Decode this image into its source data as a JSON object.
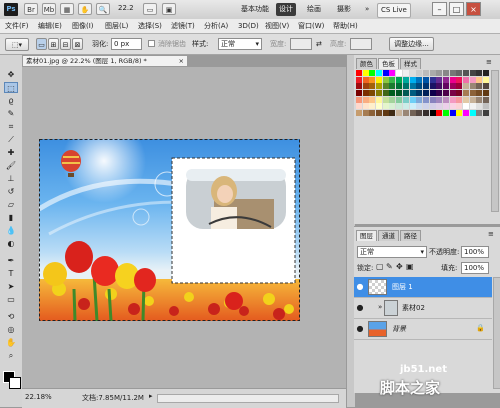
{
  "app": {
    "logo": "Ps",
    "zoom": "22.2",
    "workspaces": [
      "基本功能",
      "设计",
      "绘画",
      "摄影"
    ],
    "more": "»",
    "cs_live": "CS Live",
    "win_min": "–",
    "win_max": "□",
    "win_close": "×"
  },
  "menu": {
    "items": [
      "文件(F)",
      "编辑(E)",
      "图像(I)",
      "图层(L)",
      "选择(S)",
      "滤镜(T)",
      "分析(A)",
      "3D(D)",
      "视图(V)",
      "窗口(W)",
      "帮助(H)"
    ]
  },
  "options": {
    "feather_label": "羽化:",
    "feather_value": "0 px",
    "antialias_label": "消除锯齿",
    "style_label": "样式:",
    "style_value": "正常",
    "width_label": "宽度:",
    "height_label": "高度:",
    "refine_button": "调整边缘..."
  },
  "document": {
    "tab_title": "素材01.jpg @ 22.2% (图层 1, RGB/8) *",
    "close": "×",
    "zoom": "22.18%",
    "doc_info": "文档:7.85M/11.2M"
  },
  "swatches": {
    "tabs": [
      "颜色",
      "色板",
      "样式"
    ],
    "colors": [
      [
        "#ff0000",
        "#ffff00",
        "#00ff00",
        "#00ffff",
        "#0000ff",
        "#ff00ff",
        "#ffffff",
        "#eeeeee",
        "#dddddd",
        "#cccccc",
        "#bbbbbb",
        "#aaaaaa",
        "#999999",
        "#888888",
        "#777777",
        "#666666",
        "#555555",
        "#444444",
        "#333333",
        "#222222"
      ],
      [
        "#ed1c24",
        "#f26522",
        "#f7941d",
        "#fff200",
        "#8dc63f",
        "#39b54a",
        "#00a651",
        "#00a99d",
        "#00aeef",
        "#0072bc",
        "#0054a6",
        "#2e3192",
        "#662d91",
        "#92278f",
        "#ec008c",
        "#ed145b",
        "#f06eaa",
        "#f49ac1",
        "#fdc689",
        "#fff799"
      ],
      [
        "#9e0b0f",
        "#a0410d",
        "#a36209",
        "#aba000",
        "#598527",
        "#1a7b30",
        "#007236",
        "#00746b",
        "#0076a3",
        "#004a80",
        "#003471",
        "#1b1464",
        "#440e62",
        "#630460",
        "#9e005d",
        "#9e0039",
        "#c6b198",
        "#998675",
        "#736357",
        "#534741"
      ],
      [
        "#790000",
        "#7b2e00",
        "#7d4900",
        "#827b00",
        "#406618",
        "#005e20",
        "#005826",
        "#005952",
        "#005b7f",
        "#003663",
        "#002157",
        "#0d004c",
        "#32004b",
        "#4b0049",
        "#7b0046",
        "#7a0026",
        "#a67c52",
        "#8c6239",
        "#754c24",
        "#603913"
      ],
      [
        "#f7977a",
        "#f9ad81",
        "#fdc68a",
        "#fff79a",
        "#c4df9b",
        "#a3d39c",
        "#82ca9d",
        "#7bcdc8",
        "#6ecff6",
        "#7ea7d8",
        "#8493ca",
        "#8882be",
        "#a187be",
        "#bc8dbf",
        "#f49ac2",
        "#f6989d",
        "#e2c9a5",
        "#c7b299",
        "#998675",
        "#736357"
      ],
      [
        "#ffd8cc",
        "#ffe4cc",
        "#fff0cc",
        "#ffffcc",
        "#e5f5cc",
        "#d8f0d4",
        "#ccebd9",
        "#ccece8",
        "#cceffa",
        "#ccdcf0",
        "#cfd4ea",
        "#d4cfe8",
        "#e0d0e8",
        "#ecd0ea",
        "#fad4e5",
        "#fcd4d6",
        "#ffffff",
        "#f2f2f2",
        "#e0e0e0",
        "#c0c0c0"
      ],
      [
        "#c69c6d",
        "#a67c52",
        "#8c6239",
        "#754c24",
        "#603913",
        "#3f2a14",
        "#c7b299",
        "#998675",
        "#736357",
        "#534741",
        "#362f2d",
        "#000000",
        "#ff0000",
        "#00ff00",
        "#0000ff",
        "#ffff00",
        "#ff00ff",
        "#00ffff",
        "#808080",
        "#404040"
      ]
    ]
  },
  "layers": {
    "tabs": [
      "图层",
      "通道",
      "路径"
    ],
    "blend_mode": "正常",
    "opacity_label": "不透明度:",
    "opacity_value": "100%",
    "lock_label": "锁定:",
    "fill_label": "填充:",
    "fill_value": "100%",
    "items": [
      {
        "name": "图层 1",
        "selected": true
      },
      {
        "name": "素材02",
        "selected": false
      },
      {
        "name": "背景",
        "selected": false
      }
    ],
    "eye_icon": "●",
    "lock_icon": "🔒"
  },
  "watermark": {
    "url": "jb51.net",
    "brand": "脚本之家"
  }
}
